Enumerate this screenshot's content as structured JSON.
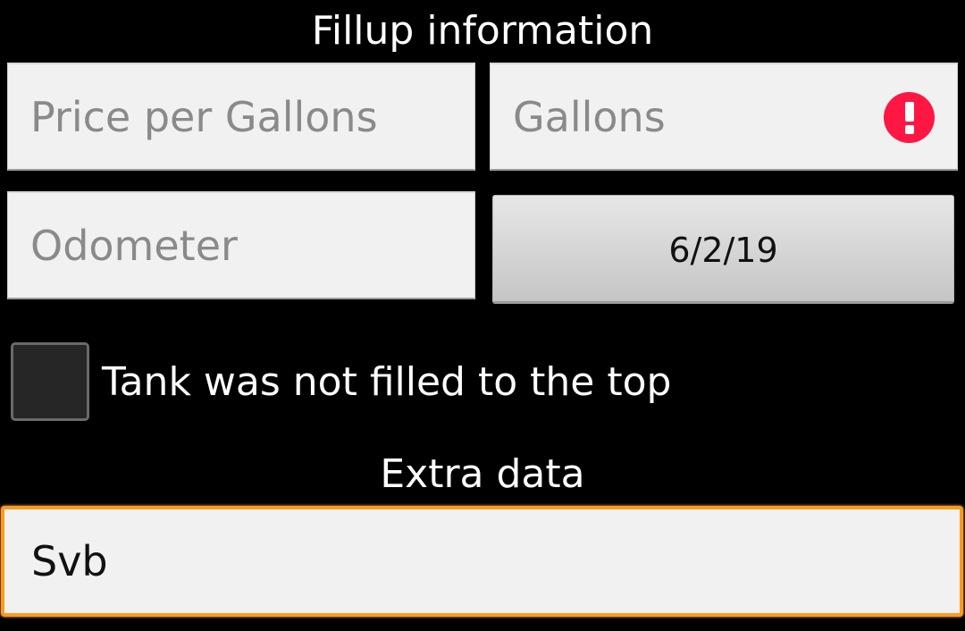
{
  "header": {
    "title": "Fillup information"
  },
  "fields": {
    "price_per_gallons": {
      "placeholder": "Price per Gallons",
      "value": ""
    },
    "gallons": {
      "placeholder": "Gallons",
      "value": "",
      "error_icon": "error-icon"
    },
    "odometer": {
      "placeholder": "Odometer",
      "value": ""
    }
  },
  "date_button": {
    "label": "6/2/19"
  },
  "checkbox": {
    "label": "Tank was not filled to the top",
    "checked": false
  },
  "extra": {
    "title": "Extra data",
    "value": "Svb"
  },
  "colors": {
    "background": "#000000",
    "field_background": "#f1f1f1",
    "error": "#ff1744",
    "focus_border": "#ff9a1f"
  }
}
